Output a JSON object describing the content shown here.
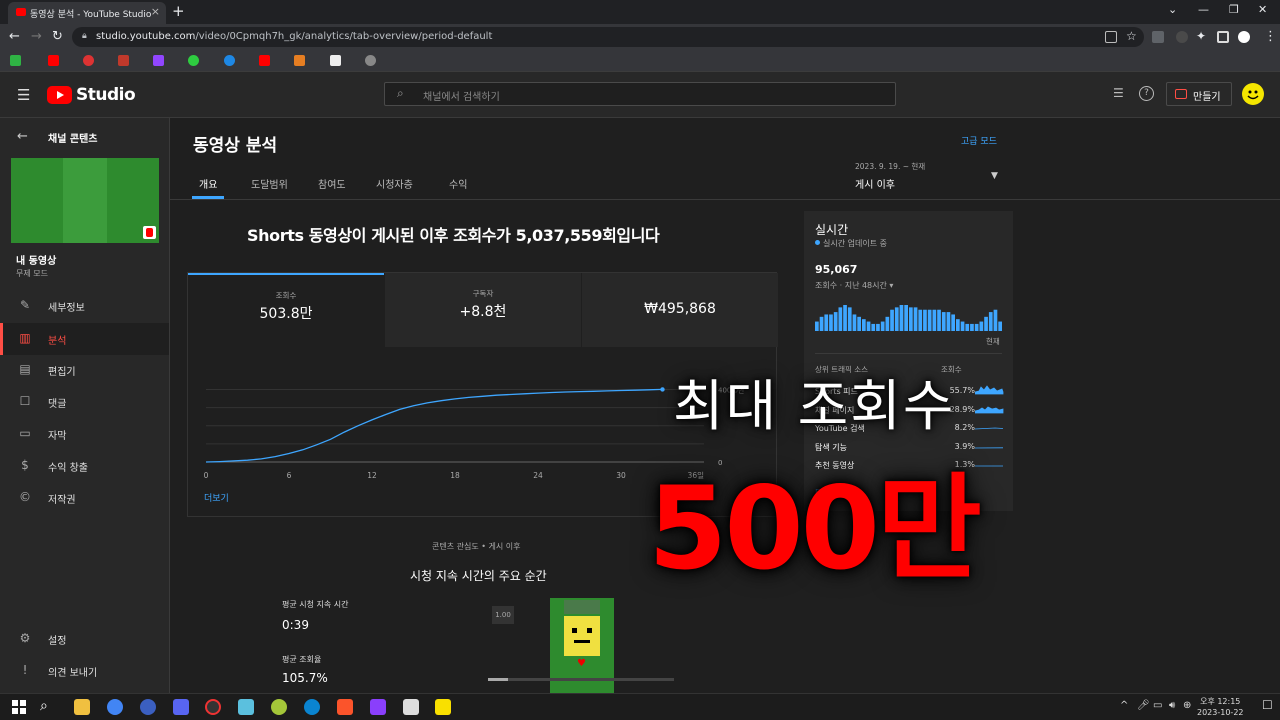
{
  "browser": {
    "tab_title": "동영상 분석 - YouTube Studio",
    "tab_close": "×",
    "new_tab": "+",
    "url_host": "studio.youtube.com",
    "url_path": "/video/0Cpmqh7h_gk/analytics/tab-overview/period-default"
  },
  "header": {
    "logo_text": "Studio",
    "search_placeholder": "채널에서 검색하기",
    "create_label": "만들기"
  },
  "sidebar": {
    "section_title": "채널 콘텐츠",
    "video_title": "내 동영상",
    "video_sub": "무제 모드",
    "items": [
      {
        "label": "세부정보",
        "icon": "pencil-icon"
      },
      {
        "label": "분석",
        "icon": "analytics-icon"
      },
      {
        "label": "편집기",
        "icon": "editor-icon"
      },
      {
        "label": "댓글",
        "icon": "comment-icon"
      },
      {
        "label": "자막",
        "icon": "subtitles-icon"
      },
      {
        "label": "수익 창출",
        "icon": "dollar-icon"
      },
      {
        "label": "저작권",
        "icon": "copyright-icon"
      }
    ],
    "settings_label": "설정",
    "feedback_label": "의견 보내기"
  },
  "main": {
    "page_title": "동영상 분석",
    "advanced_mode": "고급 모드",
    "tabs": [
      "개요",
      "도달범위",
      "참여도",
      "시청자층",
      "수익"
    ],
    "period_range": "2023. 9. 19. ~ 현재",
    "period_value": "게시 이후",
    "headline": "Shorts 동영상이 게시된 이후 조회수가 5,037,559회입니다",
    "metrics": [
      {
        "label": "조회수",
        "value": "503.8만"
      },
      {
        "label": "구독자",
        "value": "+8.8천"
      },
      {
        "label": "",
        "value": "₩495,868"
      }
    ],
    "more_label": "더보기",
    "interest_caption": "콘텐츠 관심도 • 게시 이후",
    "key_moments_title": "시청 지속 시간의 주요 순간",
    "avg_duration_label": "평균 시청 지속 시간",
    "avg_duration_value": "0:39",
    "avg_percent_label": "평균 조회율",
    "avg_percent_value": "105.7%",
    "retention_badge": "1.00"
  },
  "chart_data": {
    "type": "line",
    "x": [
      0,
      1,
      2,
      3,
      4,
      5,
      6,
      7,
      8,
      9,
      10,
      11,
      12,
      13,
      14,
      15,
      16,
      17,
      18,
      19,
      20,
      21,
      22,
      23,
      24,
      25,
      26,
      27,
      28,
      29,
      30,
      31,
      32,
      33
    ],
    "series": [
      {
        "values": [
          0,
          2,
          6,
          10,
          17,
          30,
          47,
          67,
          95,
          125,
          165,
          200,
          232,
          262,
          290,
          310,
          326,
          338,
          348,
          356,
          362,
          368,
          372,
          376,
          380,
          383,
          386,
          388,
          390,
          392,
          394,
          396,
          398,
          400
        ]
      }
    ],
    "xticks": [
      "0",
      "6",
      "12",
      "18",
      "24",
      "30",
      "36일"
    ],
    "yticks": [
      "0",
      "400.0만"
    ],
    "xlim": [
      0,
      36
    ],
    "ylim": [
      0,
      430
    ],
    "grid": true
  },
  "realtime": {
    "title": "실시간",
    "status": "실시간 업데이트 중",
    "count": "95,067",
    "caption": "조회수 · 지난 48시간",
    "now_label": "현재",
    "bars": [
      4,
      6,
      7,
      7,
      8,
      10,
      11,
      10,
      7,
      6,
      5,
      4,
      3,
      3,
      4,
      6,
      9,
      10,
      11,
      11,
      10,
      10,
      9,
      9,
      9,
      9,
      9,
      8,
      8,
      7,
      5,
      4,
      3,
      3,
      3,
      4,
      6,
      8,
      9,
      4
    ],
    "traffic_header": "상위 트래픽 소스",
    "views_header": "조회수",
    "sources": [
      {
        "name": "Shorts 피드",
        "percent": "55.7%"
      },
      {
        "name": "채널 페이지",
        "percent": "28.9%"
      },
      {
        "name": "YouTube 검색",
        "percent": "8.2%"
      },
      {
        "name": "탐색 기능",
        "percent": "3.9%"
      },
      {
        "name": "추천 동영상",
        "percent": "1.3%"
      }
    ],
    "more_label": "더보기"
  },
  "overlay": {
    "line1": "최대 조회수",
    "line2": "500만"
  },
  "taskbar": {
    "time": "오후 12:15",
    "date": "2023-10-22"
  },
  "colors": {
    "accent": "#3ea6ff",
    "brand_red": "#ff0000",
    "overlay_red": "#ff0000"
  }
}
